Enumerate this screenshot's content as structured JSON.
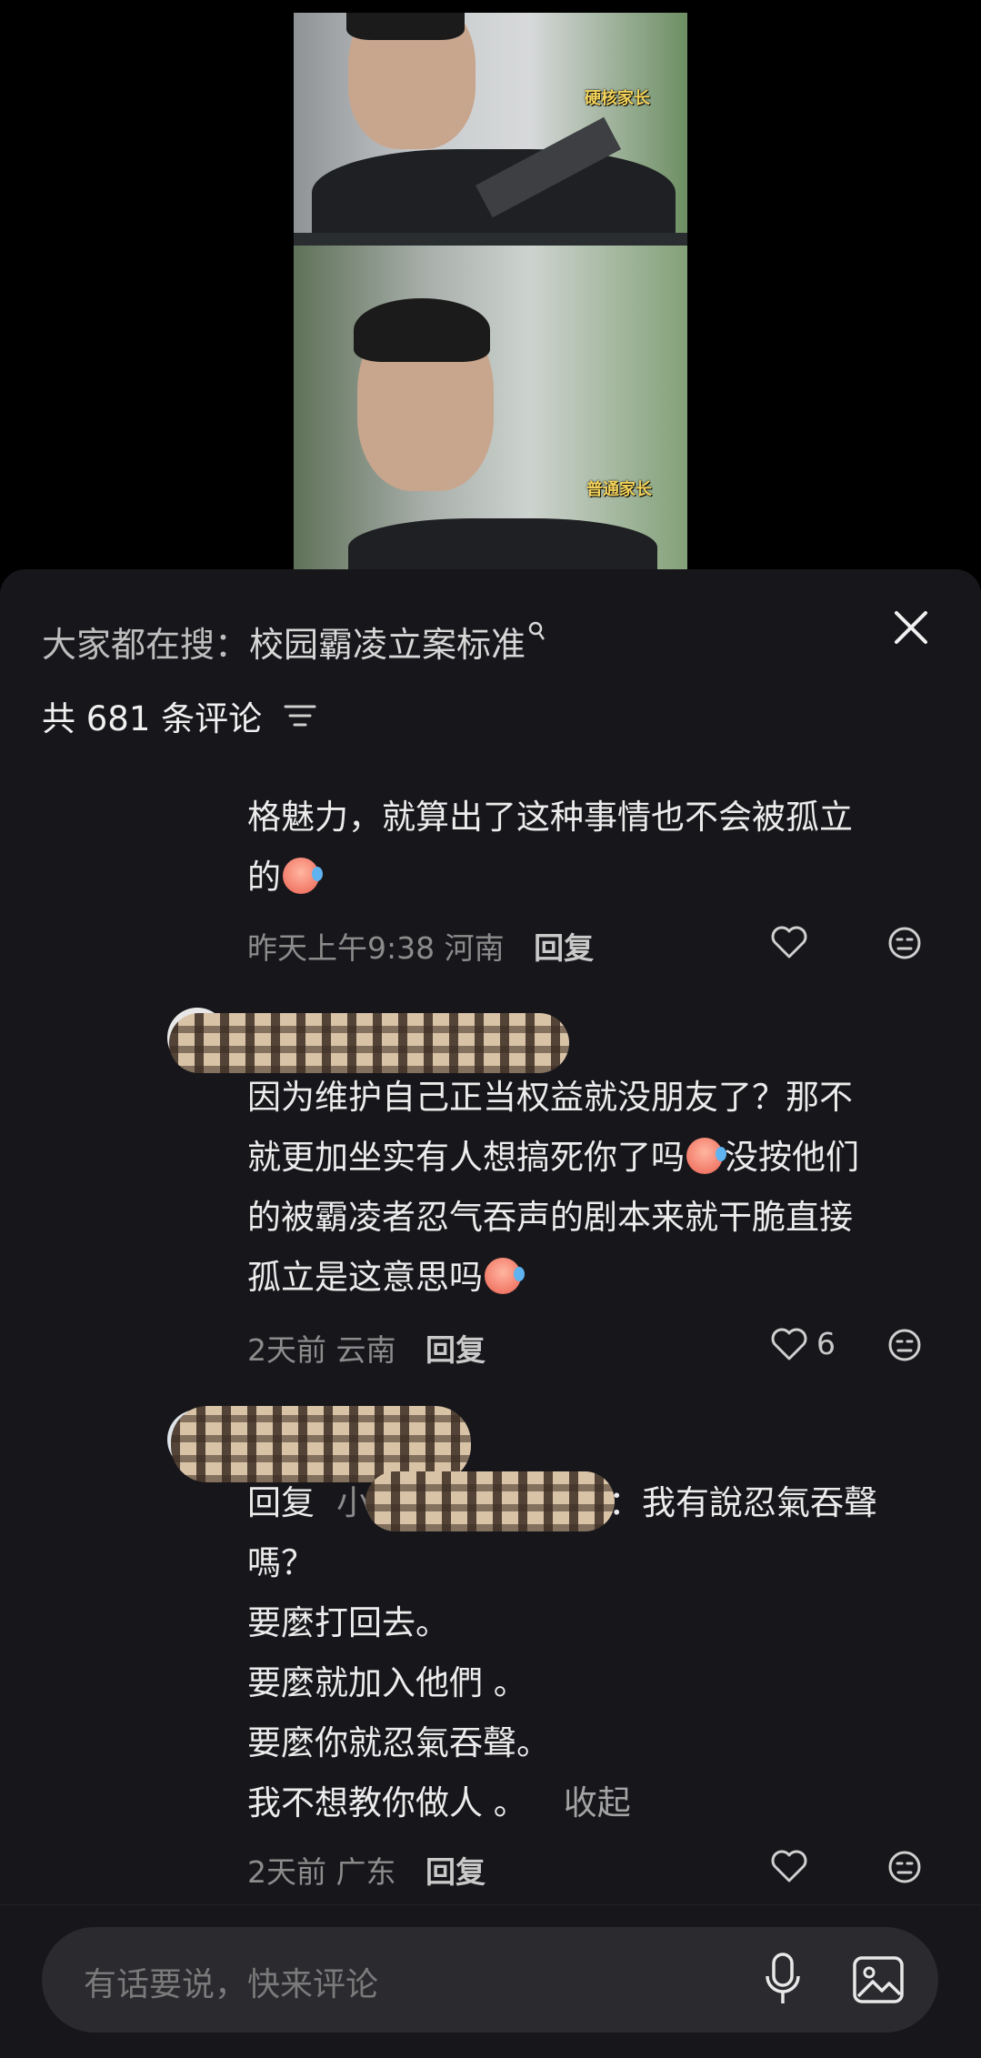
{
  "video": {
    "caption_top": "硬核家长",
    "caption_bottom": "普通家长"
  },
  "comments_sheet": {
    "search_label": "大家都在搜：",
    "search_term": "校园霸凌立案标准",
    "count_prefix": "共",
    "count_value": "681",
    "count_suffix": "条评论"
  },
  "comments": [
    {
      "text_line1": "格魅力，就算出了这种事情也不会被孤立",
      "text_line2": "的",
      "time": "昨天上午9:38",
      "location": "河南",
      "reply": "回复"
    },
    {
      "line1": "因为维护自己正当权益就没朋友了？那不",
      "line2a": "就更加坐实有人想搞死你了吗",
      "line2b": "没按他们",
      "line3": "的被霸凌者忍气吞声的剧本来就干脆直接",
      "line4": "孤立是这意思吗",
      "time": "2天前",
      "location": "云南",
      "reply": "回复",
      "likes": "6"
    },
    {
      "reply_prefix": "回复",
      "reply_to_start": "小",
      "reply_body": "：我有說忍氣吞聲",
      "line2": "嗎？",
      "line3": "要麼打回去。",
      "line4": "要麼就加入他們 。",
      "line5": "要麼你就忍氣吞聲。",
      "line6": "我不想教你做人 。",
      "collapse": "收起",
      "time": "2天前",
      "location": "广东",
      "reply": "回复"
    }
  ],
  "input": {
    "placeholder": "有话要说，快来评论"
  },
  "colors": {
    "sheet_bg": "#17171b",
    "input_bg": "#2a2a2f",
    "meta_text": "#8c8c8c"
  }
}
